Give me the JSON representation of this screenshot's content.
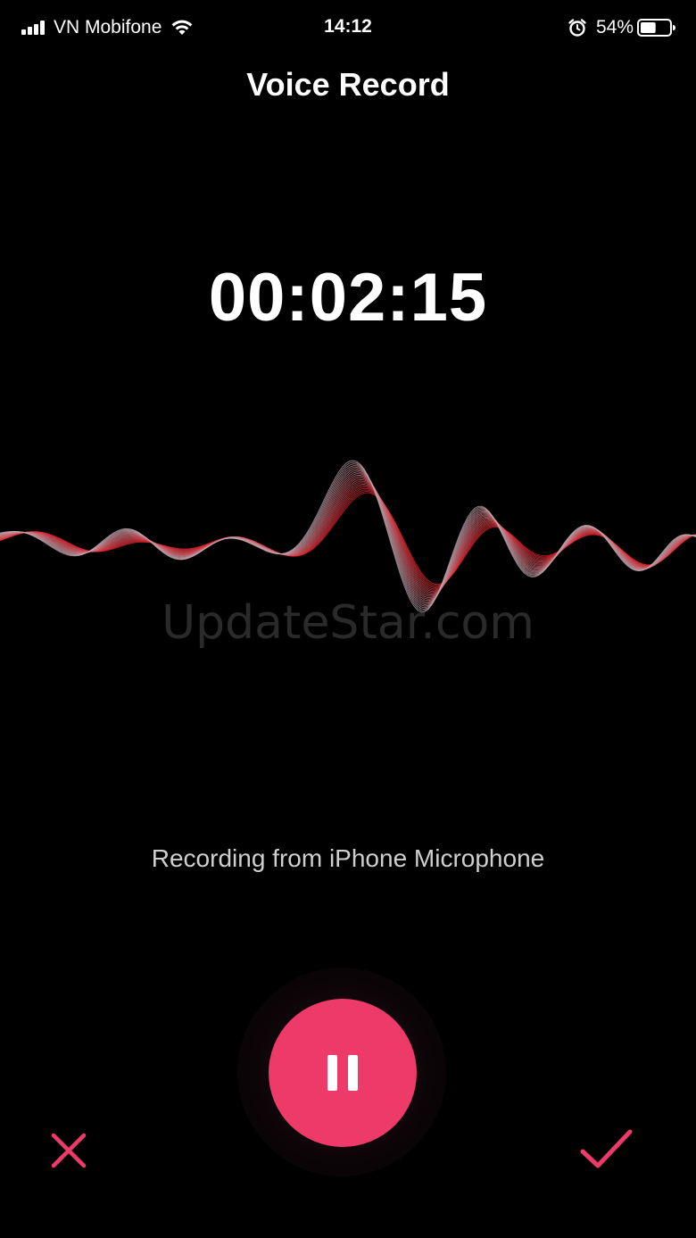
{
  "status_bar": {
    "carrier": "VN Mobifone",
    "time": "14:12",
    "battery_percent": "54%",
    "battery_level": 0.54,
    "icons": [
      "signal-icon",
      "wifi-icon",
      "alarm-icon",
      "battery-icon"
    ]
  },
  "header": {
    "title": "Voice Record"
  },
  "timer": {
    "elapsed": "00:02:15"
  },
  "waveform": {
    "watermark": "UpdateStar.com"
  },
  "recording": {
    "source_label": "Recording from iPhone Microphone"
  },
  "controls": {
    "pause_icon": "pause-icon",
    "cancel_icon": "close-icon",
    "confirm_icon": "checkmark-icon"
  },
  "colors": {
    "background": "#000000",
    "accent": "#EE3A68",
    "wave_red": "#E0202A",
    "wave_light": "#C8C8C8",
    "text_primary": "#FFFFFF",
    "text_secondary": "#CFCFCF"
  }
}
